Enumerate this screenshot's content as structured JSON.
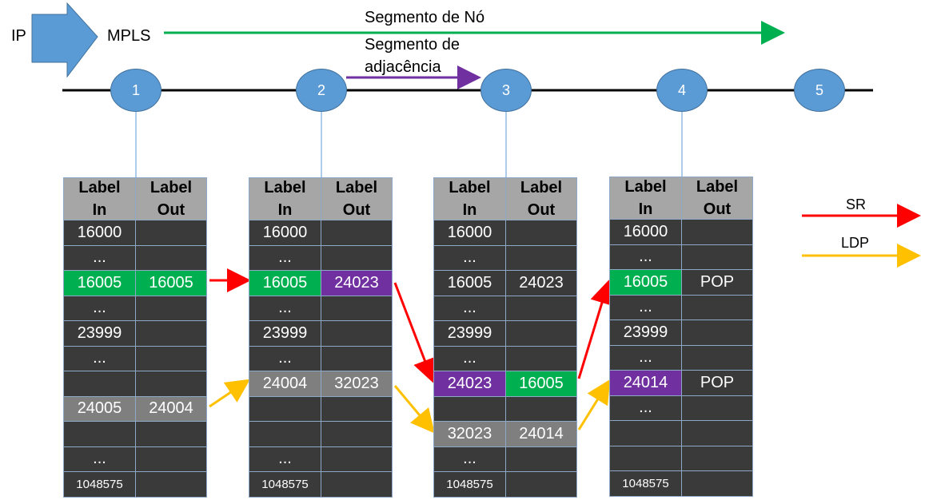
{
  "labels": {
    "ip": "IP",
    "mpls": "MPLS",
    "node_segment": "Segmento de Nó",
    "adj_segment_1": "Segmento de",
    "adj_segment_2": "adjacência",
    "sr": "SR",
    "ldp": "LDP"
  },
  "colors": {
    "sr": "#ff0000",
    "ldp": "#ffc000",
    "node_segment": "#00b050",
    "adj_segment": "#7030a0",
    "node_fill": "#5b9bd5",
    "table_bg": "#3a3a3a",
    "header_bg": "#a6a6a6",
    "highlight_green": "#00b050",
    "highlight_purple": "#7030a0",
    "highlight_gray": "#7f7f7f"
  },
  "nodes": [
    "1",
    "2",
    "3",
    "4",
    "5"
  ],
  "tables": [
    {
      "header": [
        "Label",
        "In",
        "Label",
        "Out"
      ],
      "rows": [
        [
          "16000",
          ""
        ],
        [
          "...",
          ""
        ],
        [
          "16005",
          "16005"
        ],
        [
          "...",
          ""
        ],
        [
          "23999",
          ""
        ],
        [
          "...",
          ""
        ],
        [
          "",
          ""
        ],
        [
          "24005",
          "24004"
        ],
        [
          "",
          ""
        ],
        [
          "...",
          ""
        ],
        [
          "1048575",
          ""
        ]
      ]
    },
    {
      "header": [
        "Label",
        "In",
        "Label",
        "Out"
      ],
      "rows": [
        [
          "16000",
          ""
        ],
        [
          "...",
          ""
        ],
        [
          "16005",
          "24023"
        ],
        [
          "...",
          ""
        ],
        [
          "23999",
          ""
        ],
        [
          "...",
          ""
        ],
        [
          "24004",
          "32023"
        ],
        [
          "",
          ""
        ],
        [
          "",
          ""
        ],
        [
          "...",
          ""
        ],
        [
          "1048575",
          ""
        ]
      ]
    },
    {
      "header": [
        "Label",
        "In",
        "Label",
        "Out"
      ],
      "rows": [
        [
          "16000",
          ""
        ],
        [
          "...",
          ""
        ],
        [
          "16005",
          "24023"
        ],
        [
          "...",
          ""
        ],
        [
          "23999",
          ""
        ],
        [
          "...",
          ""
        ],
        [
          "24023",
          "16005"
        ],
        [
          "",
          ""
        ],
        [
          "32023",
          "24014"
        ],
        [
          "...",
          ""
        ],
        [
          "1048575",
          ""
        ]
      ]
    },
    {
      "header": [
        "Label",
        "In",
        "Label",
        "Out"
      ],
      "rows": [
        [
          "16000",
          ""
        ],
        [
          "...",
          ""
        ],
        [
          "16005",
          "POP"
        ],
        [
          "...",
          ""
        ],
        [
          "23999",
          ""
        ],
        [
          "...",
          ""
        ],
        [
          "24014",
          "POP"
        ],
        [
          "...",
          ""
        ],
        [
          "",
          ""
        ],
        [
          "",
          ""
        ],
        [
          "1048575",
          ""
        ]
      ]
    }
  ]
}
